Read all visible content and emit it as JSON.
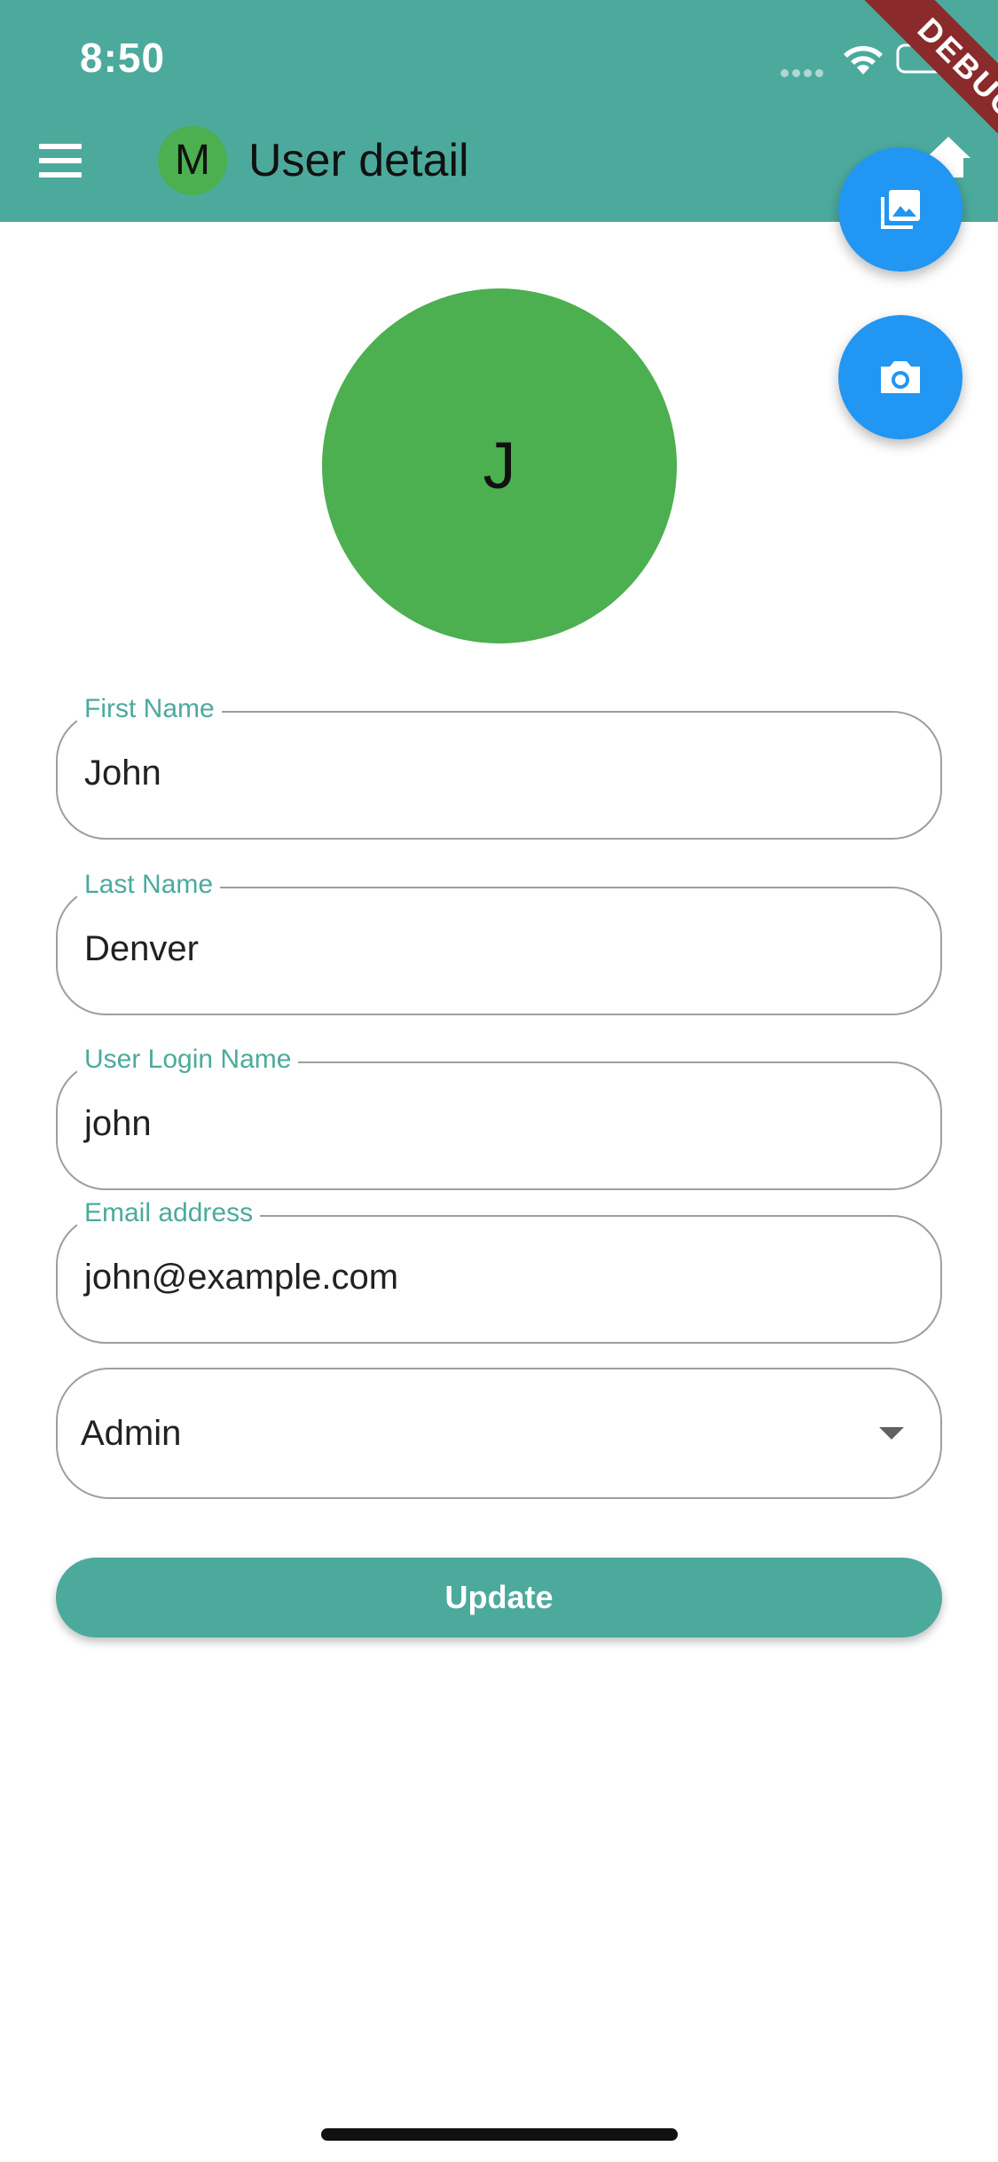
{
  "status_bar": {
    "time": "8:50"
  },
  "app_bar": {
    "title": "User detail",
    "avatar_initial": "M",
    "color": "#4caa9c"
  },
  "debug_banner": {
    "label": "DEBUG"
  },
  "profile": {
    "avatar_initial": "J",
    "avatar_color": "#4caf50"
  },
  "form": {
    "first_name": {
      "label": "First Name",
      "value": "John"
    },
    "last_name": {
      "label": "Last Name",
      "value": "Denver"
    },
    "login_name": {
      "label": "User Login Name",
      "value": "john"
    },
    "email": {
      "label": "Email address",
      "value": "john@example.com"
    },
    "role": {
      "value": "Admin"
    }
  },
  "actions": {
    "update_label": "Update",
    "fab_color": "#2196f3"
  },
  "icons": {
    "menu": "menu-icon",
    "home": "home-icon",
    "gallery": "photo-library-icon",
    "camera": "camera-icon",
    "dropdown": "arrow-drop-down-icon"
  }
}
